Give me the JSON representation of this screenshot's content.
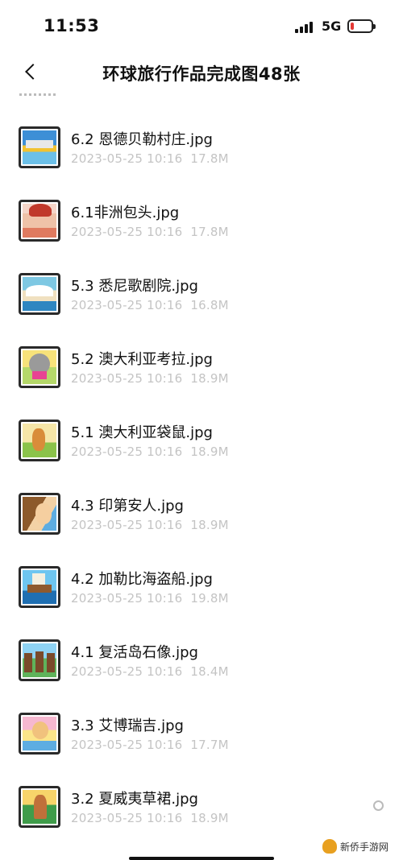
{
  "status_bar": {
    "time": "11:53",
    "network": "5G",
    "battery_level": 0.15,
    "battery_color": "#e53935"
  },
  "nav": {
    "back_icon": "chevron-left-icon",
    "title": "环球旅行作品完成图48张"
  },
  "files": [
    {
      "name": "6.2 恩德贝勒村庄.jpg",
      "date": "2023-05-25 10:16",
      "size": "17.8M"
    },
    {
      "name": "6.1非洲包头.jpg",
      "date": "2023-05-25 10:16",
      "size": "17.8M"
    },
    {
      "name": "5.3 悉尼歌剧院.jpg",
      "date": "2023-05-25 10:16",
      "size": "16.8M"
    },
    {
      "name": "5.2 澳大利亚考拉.jpg",
      "date": "2023-05-25 10:16",
      "size": "18.9M"
    },
    {
      "name": "5.1 澳大利亚袋鼠.jpg",
      "date": "2023-05-25 10:16",
      "size": "18.9M"
    },
    {
      "name": "4.3 印第安人.jpg",
      "date": "2023-05-25 10:16",
      "size": "18.9M"
    },
    {
      "name": "4.2 加勒比海盗船.jpg",
      "date": "2023-05-25 10:16",
      "size": "19.8M"
    },
    {
      "name": "4.1 复活岛石像.jpg",
      "date": "2023-05-25 10:16",
      "size": "18.4M"
    },
    {
      "name": "3.3 艾博瑞吉.jpg",
      "date": "2023-05-25 10:16",
      "size": "17.7M"
    },
    {
      "name": "3.2 夏威夷草裙.jpg",
      "date": "2023-05-25 10:16",
      "size": "18.9M"
    }
  ],
  "watermark": {
    "text": "新侨手游网"
  }
}
